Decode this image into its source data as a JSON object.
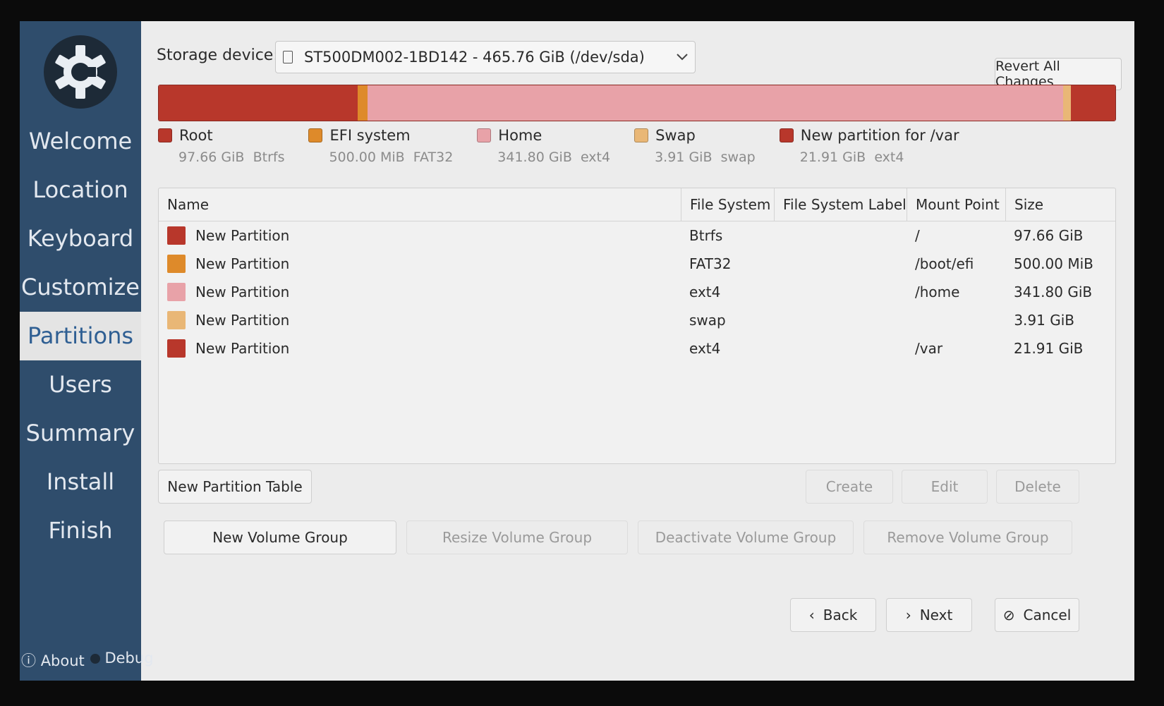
{
  "sidebar": {
    "items": [
      "Welcome",
      "Location",
      "Keyboard",
      "Customize",
      "Partitions",
      "Users",
      "Summary",
      "Install",
      "Finish"
    ],
    "active_index": 4,
    "footer": {
      "about": "About",
      "debug": "Debug"
    }
  },
  "storage": {
    "label": "Storage device:",
    "device": "ST500DM002-1BD142 - 465.76 GiB (/dev/sda)"
  },
  "revert_label": "Revert All Changes",
  "partition_bar": [
    {
      "name": "Root",
      "fraction": 0.2097,
      "color": "#b8372b"
    },
    {
      "name": "EFI system",
      "fraction": 0.0105,
      "color": "#de8a2a"
    },
    {
      "name": "Home",
      "fraction": 0.7338,
      "color": "#e8a2a8"
    },
    {
      "name": "Swap",
      "fraction": 0.0084,
      "color": "#e9b776"
    },
    {
      "name": "New partition for /var",
      "fraction": 0.047,
      "color": "#b8372b"
    }
  ],
  "legend": [
    {
      "label": "Root",
      "size": "97.66 GiB",
      "fs": "Btrfs",
      "color": "#b8372b"
    },
    {
      "label": "EFI system",
      "size": "500.00 MiB",
      "fs": "FAT32",
      "color": "#de8a2a"
    },
    {
      "label": "Home",
      "size": "341.80 GiB",
      "fs": "ext4",
      "color": "#e8a2a8"
    },
    {
      "label": "Swap",
      "size": "3.91 GiB",
      "fs": "swap",
      "color": "#e9b776"
    },
    {
      "label": "New partition for /var",
      "size": "21.91 GiB",
      "fs": "ext4",
      "color": "#b8372b"
    }
  ],
  "table": {
    "headers": [
      "Name",
      "File System",
      "File System Label",
      "Mount Point",
      "Size"
    ],
    "rows": [
      {
        "name": "New Partition",
        "fs": "Btrfs",
        "label": "",
        "mount": "/",
        "size": "97.66 GiB",
        "color": "#b8372b"
      },
      {
        "name": "New Partition",
        "fs": "FAT32",
        "label": "",
        "mount": "/boot/efi",
        "size": "500.00 MiB",
        "color": "#de8a2a"
      },
      {
        "name": "New Partition",
        "fs": "ext4",
        "label": "",
        "mount": "/home",
        "size": "341.80 GiB",
        "color": "#e8a2a8"
      },
      {
        "name": "New Partition",
        "fs": "swap",
        "label": "",
        "mount": "",
        "size": "3.91 GiB",
        "color": "#e9b776"
      },
      {
        "name": "New Partition",
        "fs": "ext4",
        "label": "",
        "mount": "/var",
        "size": "21.91 GiB",
        "color": "#b8372b"
      }
    ]
  },
  "buttons": {
    "new_partition_table": "New Partition Table",
    "create": "Create",
    "edit": "Edit",
    "delete": "Delete",
    "new_volume_group": "New Volume Group",
    "resize_volume_group": "Resize Volume Group",
    "deactivate_volume_group": "Deactivate Volume Group",
    "remove_volume_group": "Remove Volume Group",
    "back": "Back",
    "next": "Next",
    "cancel": "Cancel"
  }
}
